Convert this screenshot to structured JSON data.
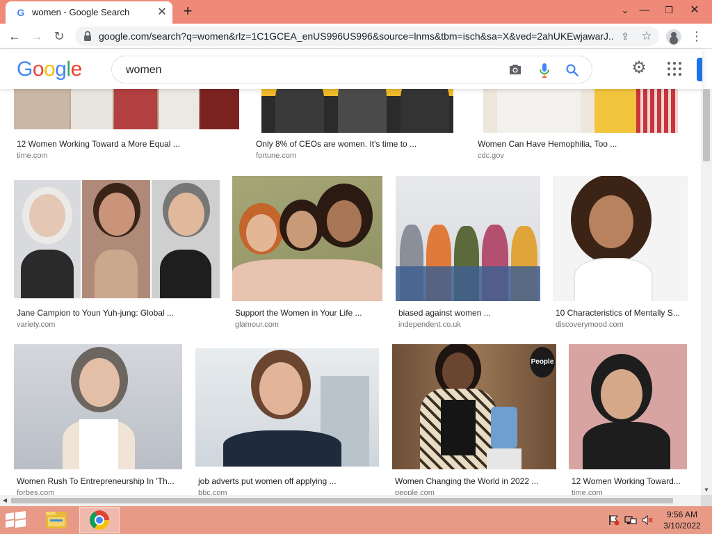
{
  "browser": {
    "tab_title": "women - Google Search",
    "tab_favicon": "G",
    "tab_close": "✕",
    "new_tab": "+",
    "tab_search": "⌄",
    "window_min": "—",
    "window_max": "❐",
    "window_close": "✕",
    "nav_back": "←",
    "nav_forward": "→",
    "nav_reload": "↻",
    "url": "google.com/search?q=women&rlz=1C1GCEA_enUS996US996&source=lnms&tbm=isch&sa=X&ved=2ahUKEwjawarJ...",
    "share": "⇪",
    "star": "☆",
    "menu": "⋮"
  },
  "google": {
    "logo": [
      "G",
      "o",
      "o",
      "g",
      "l",
      "e"
    ],
    "logo_colors": [
      "#4285f4",
      "#ea4335",
      "#fbbc05",
      "#4285f4",
      "#34a853",
      "#ea4335"
    ],
    "query": "women",
    "settings": "⚙"
  },
  "results": [
    {
      "caption": "12 Women Working Toward a More Equal ...",
      "domain": "time.com"
    },
    {
      "caption": "Only 8% of CEOs are women. It's time to ...",
      "domain": "fortune.com"
    },
    {
      "caption": "Women Can Have Hemophilia, Too ...",
      "domain": "cdc.gov"
    },
    {
      "caption": "Jane Campion to Youn Yuh-jung: Global ...",
      "domain": "variety.com"
    },
    {
      "caption": "Support the Women in Your Life ...",
      "domain": "glamour.com"
    },
    {
      "caption": "biased against women ...",
      "domain": "independent.co.uk"
    },
    {
      "caption": "10 Characteristics of Mentally S...",
      "domain": "discoverymood.com"
    },
    {
      "caption": "Women Rush To Entrepreneurship In 'Th...",
      "domain": "forbes.com"
    },
    {
      "caption": "job adverts put women off applying ...",
      "domain": "bbc.com"
    },
    {
      "caption": "Women Changing the World in 2022 ...",
      "domain": "people.com"
    },
    {
      "caption": "12 Women Working Toward...",
      "domain": "time.com"
    }
  ],
  "badge_people": "People",
  "scrollbar": {
    "up": "▲",
    "down": "▼",
    "left": "◀",
    "right": "▶"
  },
  "taskbar": {
    "time": "9:56 AM",
    "date": "3/10/2022"
  }
}
